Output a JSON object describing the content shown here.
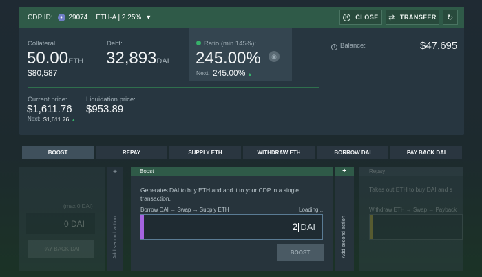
{
  "header": {
    "cdp_label": "CDP ID:",
    "cdp_id": "29074",
    "cdp_type": "ETH-A | 2.25%",
    "close_label": "CLOSE",
    "transfer_label": "TRANSFER"
  },
  "stats": {
    "collateral_label": "Collateral:",
    "collateral_value": "50.00",
    "collateral_unit": "ETH",
    "collateral_usd": "$80,587",
    "debt_label": "Debt:",
    "debt_value": "32,893",
    "debt_unit": "DAI",
    "ratio_label": "Ratio (min 145%):",
    "ratio_value": "245.00%",
    "ratio_next_label": "Next:",
    "ratio_next_value": "245.00%",
    "balance_label": "Balance:",
    "balance_value": "$47,695",
    "current_price_label": "Current price:",
    "current_price_value": "$1,611.76",
    "current_next_label": "Next:",
    "current_next_value": "$1,611.76",
    "liq_price_label": "Liquidation price:",
    "liq_price_value": "$953.89"
  },
  "tabs": [
    "BOOST",
    "REPAY",
    "SUPPLY ETH",
    "WITHDRAW ETH",
    "BORROW DAI",
    "PAY BACK DAI"
  ],
  "left_panel": {
    "max_label": "(max 0 DAI)",
    "value": "0 DAI",
    "button": "PAY BACK DAI",
    "side_plus": "+",
    "side_label": "Add second action"
  },
  "boost_panel": {
    "title": "Boost",
    "description": "Generates DAI to buy ETH and add it to your CDP in a single transaction.",
    "route": "Borrow DAI → Swap → Supply ETH",
    "loading": "Loading...",
    "amount_value": "2",
    "amount_unit": "DAI",
    "button": "BOOST",
    "side_plus": "+",
    "side_label": "Add second action"
  },
  "repay_panel": {
    "title": "Repay",
    "description": "Takes out ETH to buy DAI and s",
    "route": "Withdraw ETH → Swap → Payback"
  },
  "colors": {
    "accent_green": "#2f5a48",
    "input_bar": "#a464e0",
    "ratio_dot": "#37b06a"
  }
}
